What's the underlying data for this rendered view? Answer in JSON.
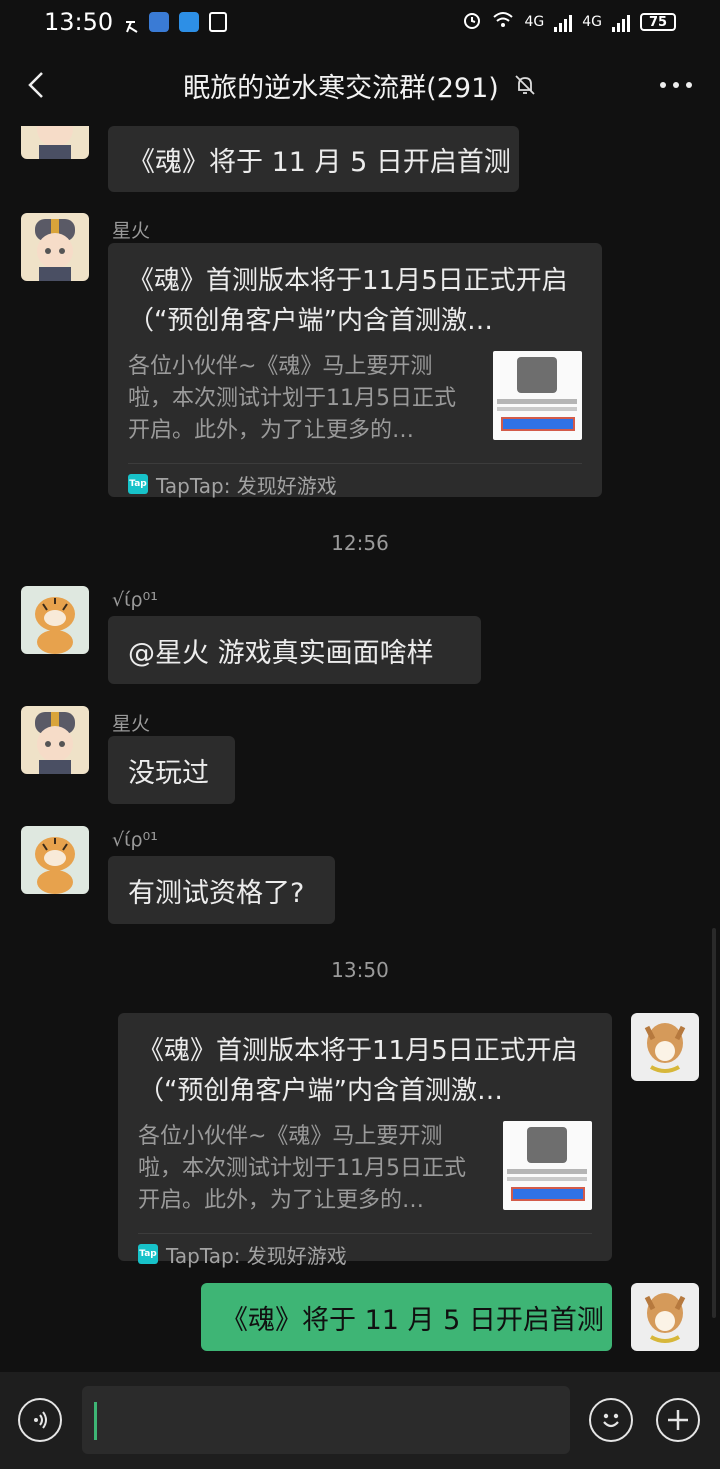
{
  "status_bar": {
    "time": "13:50",
    "network_1": "4G",
    "network_2": "4G",
    "battery": "75"
  },
  "header": {
    "title": "眠旅的逆水寒交流群(291)"
  },
  "messages": {
    "m1": {
      "text": "《魂》将于 11 月 5 日开启首测"
    },
    "m2": {
      "sender": "星火",
      "card_title": "《魂》首测版本将于11月5日正式开启（“预创角客户端”内含首测激…",
      "card_desc": "各位小伙伴~《魂》马上要开测啦，本次测试计划于11月5日正式开启。此外，为了让更多的…",
      "card_source": "TapTap: 发现好游戏",
      "source_badge": "Tap"
    },
    "time_1": "12:56",
    "m3": {
      "sender": "√ίρ⁰¹",
      "text": "@星火  游戏真实画面啥样"
    },
    "m4": {
      "sender": "星火",
      "text": "没玩过"
    },
    "m5": {
      "sender": "√ίρ⁰¹",
      "text": "有测试资格了?"
    },
    "time_2": "13:50",
    "m6": {
      "card_title": "《魂》首测版本将于11月5日正式开启（“预创角客户端”内含首测激…",
      "card_desc": "各位小伙伴~《魂》马上要开测啦，本次测试计划于11月5日正式开启。此外，为了让更多的…",
      "card_source": "TapTap: 发现好游戏",
      "source_badge": "Tap"
    },
    "m7": {
      "text": "《魂》将于 11 月 5 日开启首测"
    }
  },
  "colors": {
    "background": "#111111",
    "bubble": "#2c2c2c",
    "self_bubble": "#3eb575",
    "taptap": "#17c2c9"
  },
  "icons": {
    "back": "chevron-left-icon",
    "mute": "bell-off-icon",
    "more": "more-dots-icon",
    "voice": "voice-icon",
    "emoji": "emoji-icon",
    "add": "plus-icon"
  }
}
